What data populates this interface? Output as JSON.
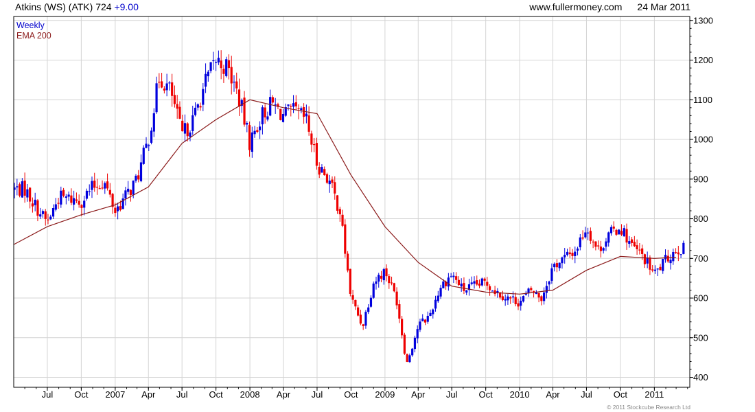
{
  "header": {
    "name": "Atkins (WS) (ATK)",
    "last": "724",
    "change": "+9.00",
    "site": "www.fullermoney.com",
    "date": "24 Mar 2011"
  },
  "legend": {
    "weekly": "Weekly",
    "ema": "EMA 200"
  },
  "copyright": "© 2011 Stockcube Research Ltd",
  "colors": {
    "up": "#0000dd",
    "down": "#ee0000",
    "ema": "#8b1a1a",
    "grid": "#d4d4d4",
    "frame": "#000000"
  },
  "chart_data": {
    "type": "line",
    "title": "Atkins (WS) (ATK) 724 +9.00",
    "series": [
      {
        "name": "Weekly",
        "style": "candlestick",
        "color_up": "#0000dd",
        "color_down": "#ee0000",
        "x": [
          "2006-05",
          "2006-06",
          "2006-07",
          "2006-08",
          "2006-09",
          "2006-10",
          "2006-11",
          "2006-12",
          "2007-01",
          "2007-02",
          "2007-03",
          "2007-04",
          "2007-05",
          "2007-06",
          "2007-07",
          "2007-08",
          "2007-09",
          "2007-10",
          "2007-11",
          "2007-12",
          "2008-01",
          "2008-02",
          "2008-03",
          "2008-04",
          "2008-05",
          "2008-06",
          "2008-07",
          "2008-08",
          "2008-09",
          "2008-10",
          "2008-11",
          "2008-12",
          "2009-01",
          "2009-02",
          "2009-03",
          "2009-04",
          "2009-05",
          "2009-06",
          "2009-07",
          "2009-08",
          "2009-09",
          "2009-10",
          "2009-11",
          "2009-12",
          "2010-01",
          "2010-02",
          "2010-03",
          "2010-04",
          "2010-05",
          "2010-06",
          "2010-07",
          "2010-08",
          "2010-09",
          "2010-10",
          "2010-11",
          "2010-12",
          "2011-01",
          "2011-02",
          "2011-03"
        ],
        "close": [
          875,
          830,
          790,
          855,
          850,
          845,
          880,
          895,
          820,
          860,
          900,
          1000,
          1160,
          1120,
          1010,
          1050,
          1140,
          1200,
          1180,
          1110,
          990,
          1060,
          1090,
          1060,
          1070,
          1050,
          940,
          900,
          820,
          600,
          530,
          640,
          670,
          600,
          435,
          530,
          555,
          630,
          660,
          620,
          630,
          640,
          615,
          600,
          590,
          620,
          600,
          680,
          700,
          720,
          780,
          720,
          760,
          780,
          730,
          705,
          660,
          695,
          724
        ]
      },
      {
        "name": "EMA 200",
        "color": "#8b1a1a",
        "x": [
          "2006-04",
          "2006-07",
          "2006-10",
          "2007-01",
          "2007-04",
          "2007-07",
          "2007-10",
          "2008-01",
          "2008-04",
          "2008-07",
          "2008-10",
          "2009-01",
          "2009-04",
          "2009-07",
          "2009-10",
          "2010-01",
          "2010-04",
          "2010-07",
          "2010-10",
          "2011-01",
          "2011-03"
        ],
        "values": [
          735,
          780,
          810,
          835,
          880,
          990,
          1050,
          1100,
          1080,
          1065,
          910,
          780,
          690,
          630,
          615,
          610,
          620,
          670,
          705,
          700,
          703
        ]
      }
    ],
    "x_tick_labels": [
      "Jul",
      "Oct",
      "2007",
      "Apr",
      "Jul",
      "Oct",
      "2008",
      "Apr",
      "Jul",
      "Oct",
      "2009",
      "Apr",
      "Jul",
      "Oct",
      "2010",
      "Apr",
      "Jul",
      "Oct",
      "2011"
    ],
    "y_tick_labels": [
      400,
      500,
      600,
      700,
      800,
      900,
      1000,
      1100,
      1200,
      1300
    ],
    "ylim": [
      375,
      1310
    ],
    "y_axis_side": "right",
    "grid": true,
    "legend_position": "top-left"
  }
}
